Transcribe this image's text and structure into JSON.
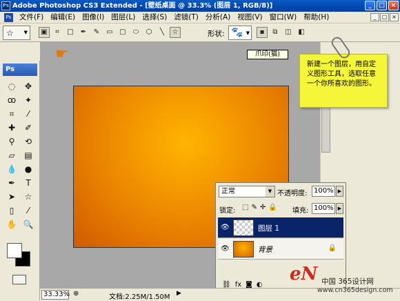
{
  "window": {
    "title": "Adobe Photoshop CS3 Extended - [壁纸桌面 @ 33.3% (图层 1, RGB/8)]",
    "ps_badge": "Ps"
  },
  "menu": [
    "文件(F)",
    "编辑(E)",
    "图像(I)",
    "图层(L)",
    "选择(S)",
    "滤镜(T)",
    "分析(A)",
    "视图(V)",
    "窗口(W)",
    "帮助(H)"
  ],
  "options": {
    "shape_label": "形状:"
  },
  "toolbox": {
    "header": "Ps"
  },
  "tooltip": "爪印(猫)",
  "note": "新建一个图层，用自定义图形工具，选取任意一个你所喜欢的图形。",
  "layers": {
    "blend_mode": "正常",
    "opacity_label": "不透明度:",
    "opacity_value": "100%",
    "lock_label": "锁定:",
    "fill_label": "填充:",
    "fill_value": "100%",
    "rows": [
      {
        "name": "图层 1",
        "selected": true
      },
      {
        "name": "背景",
        "selected": false
      }
    ]
  },
  "status": {
    "zoom": "33.33%",
    "doc": "文档:2.25M/1.50M"
  },
  "watermark": {
    "logo": "eN",
    "cn": "中国 365设计网",
    "url": "www.cn365design.com"
  },
  "colors": {
    "canvas_center": "#ffb400",
    "canvas_edge": "#d05a00",
    "note_bg": "#f5f53a",
    "selected_layer": "#0a246a"
  }
}
